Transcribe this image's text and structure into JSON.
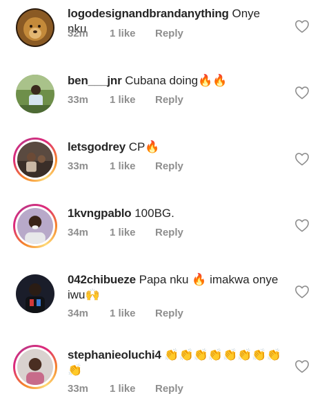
{
  "comments": [
    {
      "username": "logodesignandbrandanything",
      "text": "Onye nku",
      "time": "32m",
      "likes": "1 like",
      "reply": "Reply"
    },
    {
      "username": "ben___jnr",
      "text": "Cubana doing🔥🔥",
      "time": "33m",
      "likes": "1 like",
      "reply": "Reply"
    },
    {
      "username": "letsgodrey",
      "text": "CP🔥",
      "time": "33m",
      "likes": "1 like",
      "reply": "Reply"
    },
    {
      "username": "1kvngpablo",
      "text": "100BG.",
      "time": "34m",
      "likes": "1 like",
      "reply": "Reply"
    },
    {
      "username": "042chibueze",
      "text": "Papa nku 🔥 imakwa onye iwu🙌",
      "time": "34m",
      "likes": "1 like",
      "reply": "Reply"
    },
    {
      "username": "stephanieoluchi4",
      "text": "👏👏👏👏👏👏👏👏👏",
      "time": "33m",
      "likes": "1 like",
      "reply": "Reply"
    }
  ],
  "icons": {
    "like": "heart-outline-icon"
  },
  "colors": {
    "text": "#262626",
    "meta": "#8e8e8e",
    "story_ring_start": "#f58529",
    "story_ring_end": "#dd2a7b"
  }
}
